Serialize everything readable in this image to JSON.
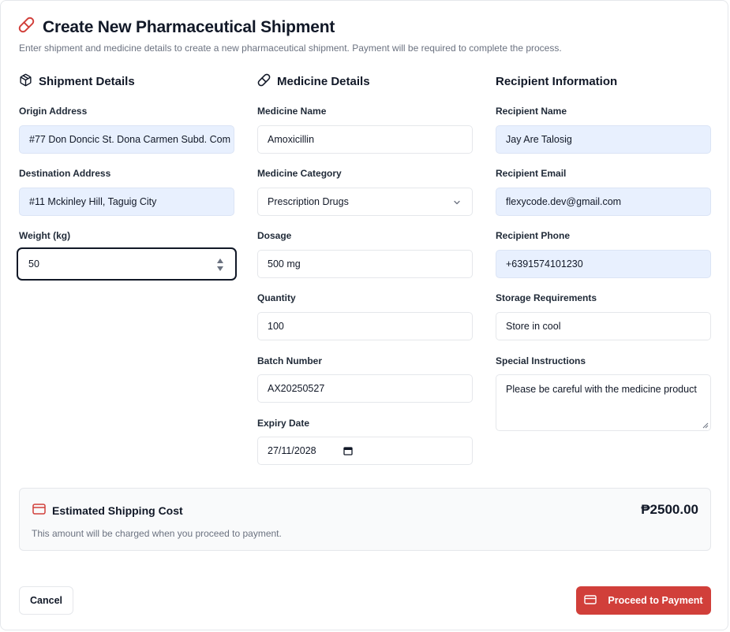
{
  "header": {
    "title": "Create New Pharmaceutical Shipment",
    "subtitle": "Enter shipment and medicine details to create a new pharmaceutical shipment. Payment will be required to complete the process."
  },
  "shipment": {
    "title": "Shipment Details",
    "origin_label": "Origin Address",
    "origin_value": "#77 Don Doncic St. Dona Carmen Subd. Com",
    "destination_label": "Destination Address",
    "destination_value": "#11 Mckinley Hill, Taguig City",
    "weight_label": "Weight (kg)",
    "weight_value": "50"
  },
  "medicine": {
    "title": "Medicine Details",
    "name_label": "Medicine Name",
    "name_value": "Amoxicillin",
    "category_label": "Medicine Category",
    "category_value": "Prescription Drugs",
    "dosage_label": "Dosage",
    "dosage_value": "500 mg",
    "quantity_label": "Quantity",
    "quantity_value": "100",
    "batch_label": "Batch Number",
    "batch_value": "AX20250527",
    "expiry_label": "Expiry Date",
    "expiry_value": "27/11/2028"
  },
  "recipient": {
    "title": "Recipient Information",
    "name_label": "Recipient Name",
    "name_value": "Jay Are Talosig",
    "email_label": "Recipient Email",
    "email_value": "flexycode.dev@gmail.com",
    "phone_label": "Recipient Phone",
    "phone_value": "+6391574101230",
    "storage_label": "Storage Requirements",
    "storage_value": "Store in cool",
    "instructions_label": "Special Instructions",
    "instructions_value": "Please be careful with the medicine product"
  },
  "cost": {
    "title": "Estimated Shipping Cost",
    "amount": "₱2500.00",
    "note": "This amount will be charged when you proceed to payment."
  },
  "actions": {
    "cancel_label": "Cancel",
    "pay_label": "Proceed to Payment"
  },
  "icons": {
    "header": "pill-icon",
    "shipment": "package-icon",
    "medicine": "pill-icon",
    "cost": "credit-card-icon",
    "pay": "credit-card-icon"
  },
  "colors": {
    "accent": "#d13f3a",
    "filled_input": "#e8f0fe"
  }
}
